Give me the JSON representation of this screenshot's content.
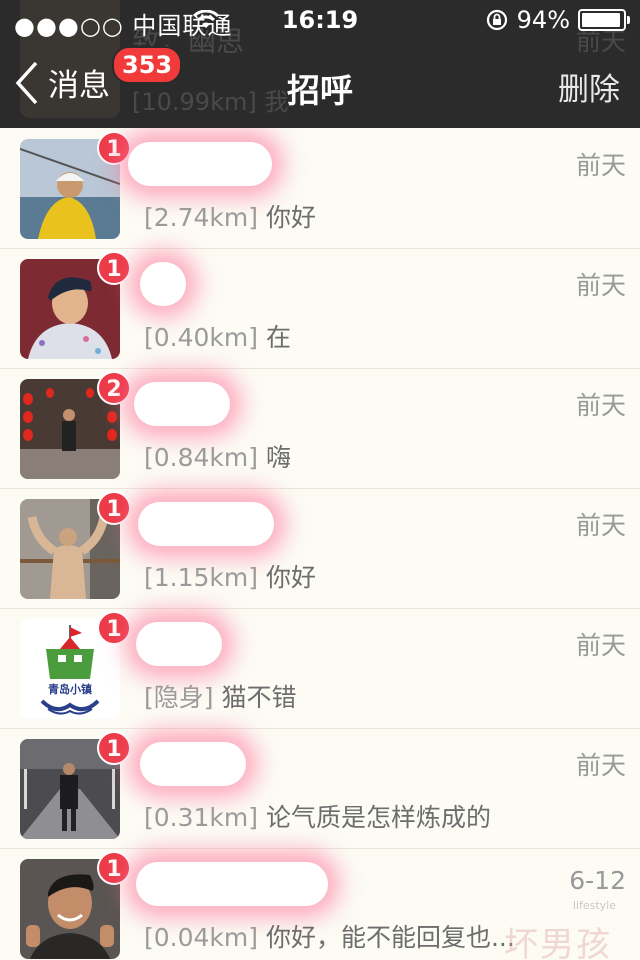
{
  "status": {
    "carrier": "●●●○○ 中国联通",
    "time": "16:19",
    "battery": "94%",
    "battery_level": 0.94
  },
  "nav": {
    "back_label": "消息",
    "unread_total": "353",
    "title": "招呼",
    "delete_label": "删除"
  },
  "background_text": {
    "line1": "致，幽思",
    "line2": "[10.99km] 我",
    "time": "前天"
  },
  "conversations": [
    {
      "unread": "1",
      "distance": "[2.74km]",
      "message": "你好",
      "time": "前天"
    },
    {
      "unread": "1",
      "distance": "[0.40km]",
      "message": "在",
      "time": "前天"
    },
    {
      "unread": "2",
      "distance": "[0.84km]",
      "message": "嗨",
      "time": "前天"
    },
    {
      "unread": "1",
      "distance": "[1.15km]",
      "message": "你好",
      "time": "前天"
    },
    {
      "unread": "1",
      "distance": "[隐身]",
      "message": "猫不错",
      "time": "前天",
      "avatar_text": "青岛小镇"
    },
    {
      "unread": "1",
      "distance": "[0.31km]",
      "message": "论气质是怎样炼成的",
      "time": "前天"
    },
    {
      "unread": "1",
      "distance": "[0.04km]",
      "message": "你好，能不能回复也...",
      "time": "6-12"
    }
  ],
  "watermark": {
    "text": "坏男孩",
    "sub": "lifestyle"
  },
  "colors": {
    "header_bg": "#2b2b2b",
    "badge_red": "#ed3b49",
    "list_bg": "#fcfbf4"
  }
}
